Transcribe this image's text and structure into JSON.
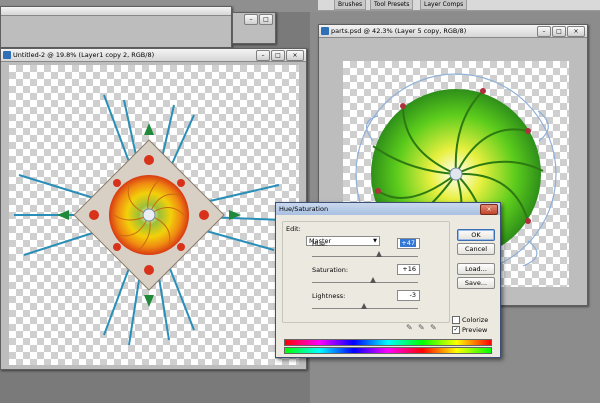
{
  "panel_tabs": {
    "brushes": "Brushes",
    "tool_presets": "Tool Presets",
    "layer_comps": "Layer Comps"
  },
  "left_window": {
    "title": "Untitled-2 @ 19.8% (Layer1 copy 2, RGB/8)"
  },
  "right_window": {
    "title": "parts.psd @ 42.3% (Layer 5 copy, RGB/8)"
  },
  "dialog": {
    "title": "Hue/Saturation",
    "edit_label": "Edit:",
    "edit_value": "Master",
    "hue_label": "Hue:",
    "hue_value": "+47",
    "saturation_label": "Saturation:",
    "saturation_value": "+16",
    "lightness_label": "Lightness:",
    "lightness_value": "-3",
    "hue_level": 0.63,
    "saturation_level": 0.58,
    "lightness_level": 0.49,
    "ok_label": "OK",
    "cancel_label": "Cancel",
    "load_label": "Load...",
    "save_label": "Save...",
    "colorize_label": "Colorize",
    "colorize_checked": false,
    "preview_label": "Preview",
    "preview_checked": true
  }
}
